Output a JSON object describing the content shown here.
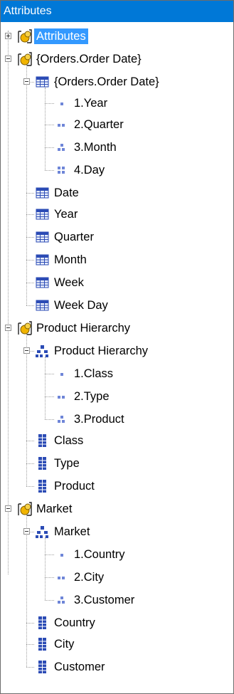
{
  "panel": {
    "title": "Attributes"
  },
  "tree": [
    {
      "label": "Attributes",
      "icon": "dimension-icon",
      "selected": true,
      "expander": "plus"
    },
    {
      "label": "{Orders.Order Date}",
      "icon": "dimension-icon",
      "expander": "minus"
    },
    {
      "label": "{Orders.Order Date}",
      "icon": "table-icon",
      "expander": "minus"
    },
    {
      "label": "1.Year",
      "icon": "level-1-icon"
    },
    {
      "label": "2.Quarter",
      "icon": "level-2-icon"
    },
    {
      "label": "3.Month",
      "icon": "level-3-icon"
    },
    {
      "label": "4.Day",
      "icon": "level-4-icon"
    },
    {
      "label": "Date",
      "icon": "table-icon"
    },
    {
      "label": "Year",
      "icon": "table-icon"
    },
    {
      "label": "Quarter",
      "icon": "table-icon"
    },
    {
      "label": "Month",
      "icon": "table-icon"
    },
    {
      "label": "Week",
      "icon": "table-icon"
    },
    {
      "label": "Week Day",
      "icon": "table-icon"
    },
    {
      "label": "Product Hierarchy",
      "icon": "dimension-icon",
      "expander": "minus"
    },
    {
      "label": "Product Hierarchy",
      "icon": "hierarchy-icon",
      "expander": "minus"
    },
    {
      "label": "1.Class",
      "icon": "level-1-icon"
    },
    {
      "label": "2.Type",
      "icon": "level-2-icon"
    },
    {
      "label": "3.Product",
      "icon": "level-3-icon"
    },
    {
      "label": "Class",
      "icon": "attribute-icon"
    },
    {
      "label": "Type",
      "icon": "attribute-icon"
    },
    {
      "label": "Product",
      "icon": "attribute-icon"
    },
    {
      "label": "Market",
      "icon": "dimension-icon",
      "expander": "minus"
    },
    {
      "label": "Market",
      "icon": "hierarchy-icon",
      "expander": "minus"
    },
    {
      "label": "1.Country",
      "icon": "level-1-icon"
    },
    {
      "label": "2.City",
      "icon": "level-2-icon"
    },
    {
      "label": "3.Customer",
      "icon": "level-3-icon"
    },
    {
      "label": "Country",
      "icon": "attribute-icon"
    },
    {
      "label": "City",
      "icon": "attribute-icon"
    },
    {
      "label": "Customer",
      "icon": "attribute-icon"
    }
  ]
}
